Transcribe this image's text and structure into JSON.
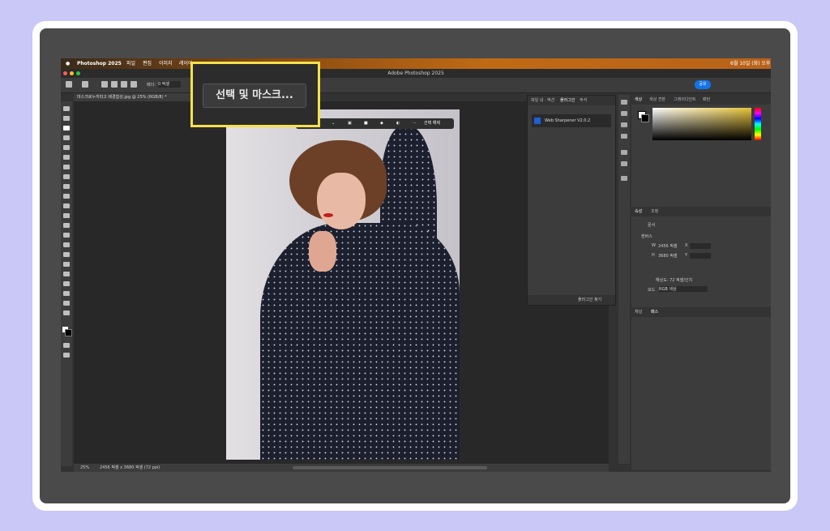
{
  "menubar": {
    "apple": "",
    "app_name": "Photoshop 2025",
    "items": [
      "파일",
      "편집",
      "이미지",
      "레이어"
    ],
    "clock": "6월 10일 (화) 오후"
  },
  "window": {
    "title": "Adobe Photoshop 2025"
  },
  "options_bar": {
    "feather_label": "페더:",
    "feather_value": "0 픽셀",
    "share_label": "공유"
  },
  "document": {
    "tab_label": "마스크로누끼따고 배경합성.jpg @ 25% (RGB/8) *"
  },
  "contextual_toolbar": {
    "deselect_label": "선택 해제"
  },
  "callout": {
    "select_and_mask_label": "선택 및 마스크..."
  },
  "plugin_panel": {
    "tabs": [
      "파일 내 ·",
      "액션",
      "플러그인",
      "주석"
    ],
    "item_label": "Web Sharpener V2.0.2",
    "footer_label": "플러그인 찾기"
  },
  "right_panels": {
    "color_tabs": [
      "색상",
      "색상 견본",
      "그레이디언트",
      "패턴"
    ],
    "properties_tabs": [
      "속성",
      "조정"
    ],
    "doc_label": "문서",
    "canvas_section": "캔버스",
    "w_label": "W",
    "w_value": "2456 픽셀",
    "x_label": "X",
    "h_label": "H",
    "h_value": "3680 픽셀",
    "y_label": "Y",
    "resolution_label": "해상도: 72 픽셀/인치",
    "mode_label": "모드",
    "mode_value": "RGB 색상",
    "layers_tabs": [
      "채널",
      "패스"
    ]
  },
  "status_bar": {
    "zoom": "25%",
    "doc_info": "2456 픽셀 x 3680 픽셀 (72 ppi)"
  }
}
